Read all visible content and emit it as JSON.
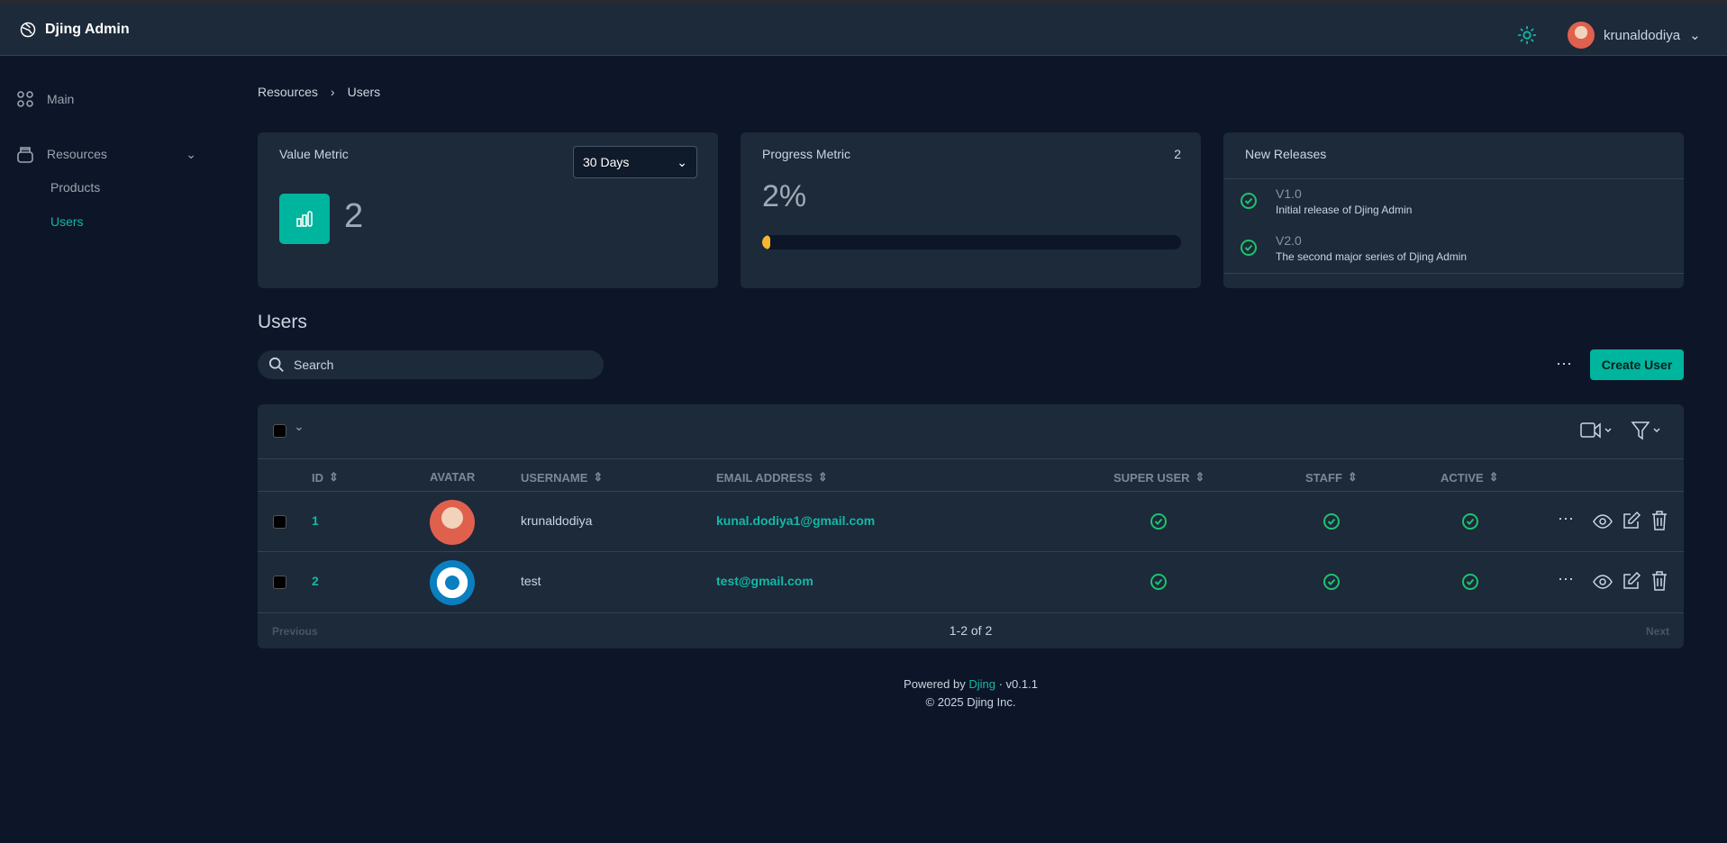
{
  "app": {
    "title": "Djing Admin",
    "username": "krunaldodiya"
  },
  "sidebar": {
    "items": [
      {
        "label": "Main",
        "icon": "grid-icon"
      },
      {
        "label": "Resources",
        "icon": "database-icon",
        "children": [
          {
            "label": "Products"
          },
          {
            "label": "Users",
            "active": true
          }
        ]
      }
    ]
  },
  "breadcrumb": [
    "Resources",
    "Users"
  ],
  "metrics": {
    "value": {
      "title": "Value Metric",
      "range": "30 Days",
      "value": "2"
    },
    "progress": {
      "title": "Progress Metric",
      "target": "2",
      "value": "2%",
      "percent": 2
    },
    "releases": {
      "title": "New Releases",
      "items": [
        {
          "version": "V1.0",
          "desc": "Initial release of Djing Admin"
        },
        {
          "version": "V2.0",
          "desc": "The second major series of Djing Admin"
        }
      ]
    }
  },
  "users": {
    "heading": "Users",
    "search_placeholder": "Search",
    "create_label": "Create User",
    "columns": [
      "ID",
      "AVATAR",
      "USERNAME",
      "EMAIL ADDRESS",
      "SUPER USER",
      "STAFF",
      "ACTIVE"
    ],
    "rows": [
      {
        "id": "1",
        "username": "krunaldodiya",
        "email": "kunal.dodiya1@gmail.com",
        "super": true,
        "staff": true,
        "active": true
      },
      {
        "id": "2",
        "username": "test",
        "email": "test@gmail.com",
        "super": true,
        "staff": true,
        "active": true
      }
    ],
    "pagination": {
      "prev": "Previous",
      "info": "1-2 of 2",
      "next": "Next"
    }
  },
  "footer": {
    "powered": "Powered by",
    "brand": "Djing",
    "version": "· v0.1.1",
    "copyright": "© 2025 Djing Inc."
  },
  "colors": {
    "accent": "#14b8a6",
    "check": "#1ec26e",
    "progress": "#f5b731"
  }
}
